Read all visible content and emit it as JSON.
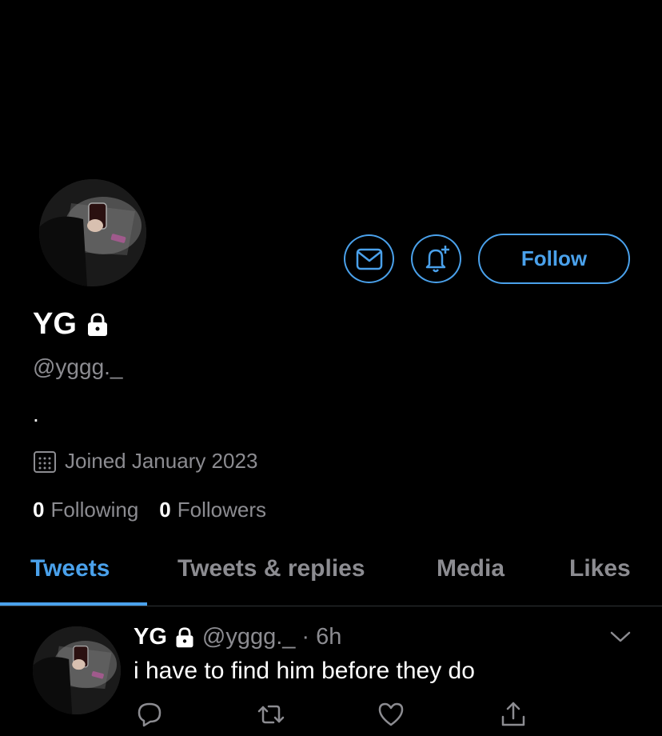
{
  "profile": {
    "display_name": "YG",
    "handle": "@yggg._",
    "bio": ".",
    "joined": "Joined January 2023",
    "following_count": "0",
    "following_label": "Following",
    "followers_count": "0",
    "followers_label": "Followers"
  },
  "actions": {
    "follow_label": "Follow",
    "message_icon": "mail-icon",
    "notify_icon": "bell-plus-icon"
  },
  "tabs": [
    {
      "label": "Tweets",
      "active": true
    },
    {
      "label": "Tweets & replies",
      "active": false
    },
    {
      "label": "Media",
      "active": false
    },
    {
      "label": "Likes",
      "active": false
    }
  ],
  "tweet": {
    "name": "YG",
    "handle": "@yggg._",
    "separator": "·",
    "time": "6h",
    "text": "i have to find him before they do"
  },
  "colors": {
    "accent": "#4aa1eb",
    "background": "#000000",
    "secondary_text": "#8c8c91"
  }
}
